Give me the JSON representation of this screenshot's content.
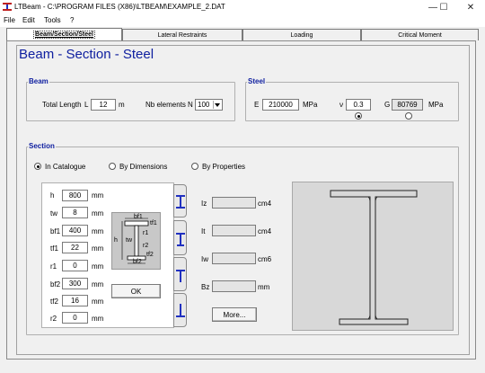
{
  "window": {
    "title": "LTBeam - C:\\PROGRAM FILES (X86)\\LTBEAM\\EXAMPLE_2.DAT",
    "minimize": "—",
    "maximize": "☐",
    "close": "✕"
  },
  "menu": {
    "items": [
      "File",
      "Edit",
      "Tools",
      "?"
    ]
  },
  "tabs": [
    "Beam/Section/Steel",
    "Lateral Restraints",
    "Loading",
    "Critical Moment"
  ],
  "page_title": "Beam - Section - Steel",
  "beam": {
    "group_label": "Beam",
    "total_length_label": "Total Length",
    "total_length_var": "L",
    "total_length_value": "12",
    "total_length_unit": "m",
    "nb_elements_label": "Nb elements",
    "nb_elements_var": "N",
    "nb_elements_value": "100"
  },
  "steel": {
    "group_label": "Steel",
    "e_label": "E",
    "e_value": "210000",
    "e_unit": "MPa",
    "nu_label": "ν",
    "nu_value": "0.3",
    "g_label": "G",
    "g_value": "80769",
    "g_unit": "MPa"
  },
  "section": {
    "group_label": "Section",
    "modes": [
      "In Catalogue",
      "By Dimensions",
      "By Properties"
    ],
    "selected_mode": "In Catalogue",
    "dimensions": [
      {
        "label": "h",
        "value": "800",
        "unit": "mm"
      },
      {
        "label": "tw",
        "value": "8",
        "unit": "mm"
      },
      {
        "label": "bf1",
        "value": "400",
        "unit": "mm"
      },
      {
        "label": "tf1",
        "value": "22",
        "unit": "mm"
      },
      {
        "label": "r1",
        "value": "0",
        "unit": "mm"
      },
      {
        "label": "bf2",
        "value": "300",
        "unit": "mm"
      },
      {
        "label": "tf2",
        "value": "16",
        "unit": "mm"
      },
      {
        "label": "r2",
        "value": "0",
        "unit": "mm"
      }
    ],
    "diagram_labels": {
      "bf1": "bf1",
      "tf1": "tf1",
      "r1": "r1",
      "h": "h",
      "tw": "tw",
      "r2": "r2",
      "tf2": "tf2",
      "bf2": "bf2"
    },
    "ok_label": "OK",
    "properties": [
      {
        "label": "Iz",
        "value": "",
        "unit": "cm4"
      },
      {
        "label": "It",
        "value": "",
        "unit": "cm4"
      },
      {
        "label": "Iw",
        "value": "",
        "unit": "cm6"
      },
      {
        "label": "Bz",
        "value": "",
        "unit": "mm"
      }
    ],
    "more_label": "More..."
  },
  "icons": {
    "app": "ltbeam-app-icon",
    "dropdown": "chevron-down-icon",
    "side_tabs": [
      "double-i-section-icon",
      "mono-i-section-icon",
      "t-section-icon",
      "inverted-t-section-icon"
    ]
  },
  "colors": {
    "title_blue": "#1020a0",
    "section_icon_blue": "#2030c0"
  }
}
